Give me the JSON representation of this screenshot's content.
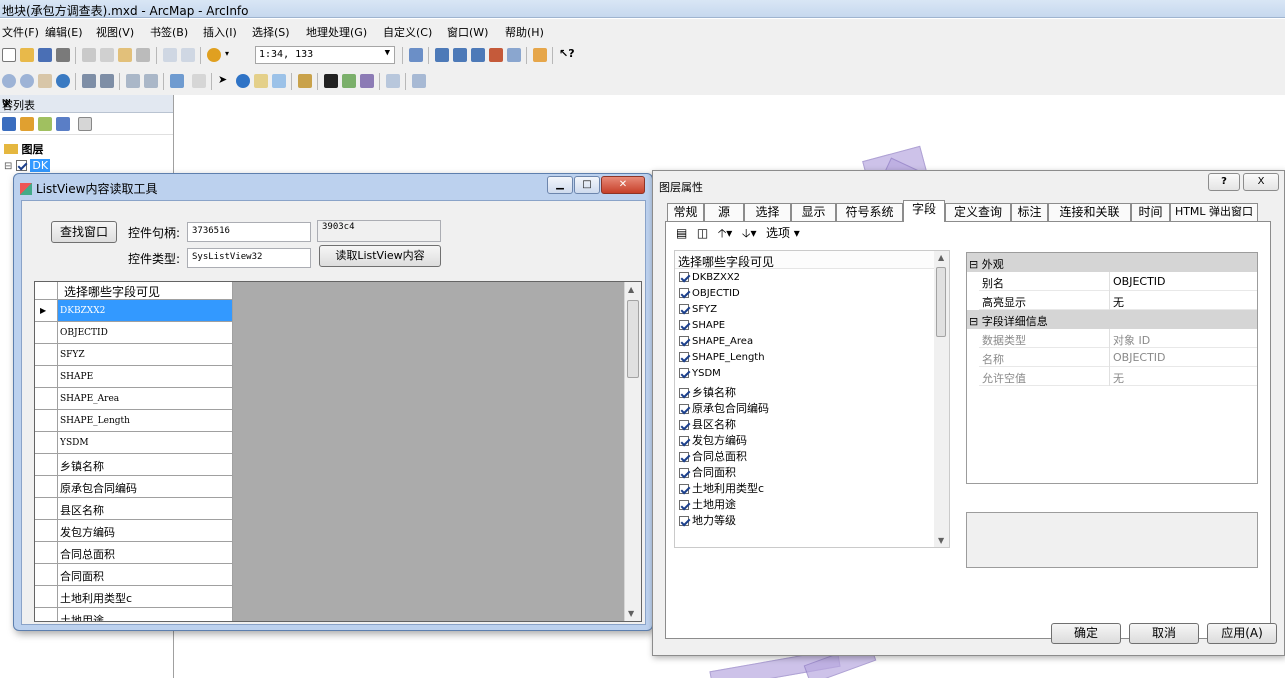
{
  "app": {
    "title": "地块(承包方调查表).mxd - ArcMap - ArcInfo",
    "menu": [
      "文件(F)",
      "编辑(E)",
      "视图(V)",
      "书签(B)",
      "插入(I)",
      "选择(S)",
      "地理处理(G)",
      "自定义(C)",
      "窗口(W)",
      "帮助(H)"
    ],
    "scale": "1:34, 133"
  },
  "toc": {
    "title": "容列表",
    "pin": "Ψ",
    "close": "×",
    "layers_group": "图层",
    "layer_name": "DK"
  },
  "listview_tool": {
    "title": "ListView内容读取工具",
    "find_button": "查找窗口",
    "handle_label": "控件句柄:",
    "handle_value": "3736516",
    "handle_hex": "3903c4",
    "type_label": "控件类型:",
    "type_value": "SysListView32",
    "read_button": "读取ListView内容",
    "grid_header": "选择哪些字段可见",
    "row_marker": "▶",
    "rows": [
      "DKBZXX2",
      "OBJECTID",
      "SFYZ",
      "SHAPE",
      "SHAPE_Area",
      "SHAPE_Length",
      "YSDM",
      "乡镇名称",
      "原承包合同编码",
      "县区名称",
      "发包方编码",
      "合同总面积",
      "合同面积",
      "土地利用类型c",
      "土地用途"
    ]
  },
  "layer_props": {
    "title": "图层属性",
    "help": "?",
    "close": "X",
    "tabs": [
      "常规",
      "源",
      "选择",
      "显示",
      "符号系统",
      "字段",
      "定义查询",
      "标注",
      "连接和关联",
      "时间",
      "HTML 弹出窗口"
    ],
    "active_tab": "字段",
    "options_label": "选项 ▾",
    "field_list_header": "选择哪些字段可见",
    "fields": [
      "DKBZXX2",
      "OBJECTID",
      "SFYZ",
      "SHAPE",
      "SHAPE_Area",
      "SHAPE_Length",
      "YSDM",
      "乡镇名称",
      "原承包合同编码",
      "县区名称",
      "发包方编码",
      "合同总面积",
      "合同面积",
      "土地利用类型c",
      "土地用途",
      "地力等级"
    ],
    "appearance_cat": "外观",
    "alias_key": "别名",
    "alias_val": "OBJECTID",
    "highlight_key": "高亮显示",
    "highlight_val": "无",
    "details_cat": "字段详细信息",
    "dtype_key": "数据类型",
    "dtype_val": "对象 ID",
    "name_key": "名称",
    "name_val": "OBJECTID",
    "nullable_key": "允许空值",
    "nullable_val": "无",
    "ok": "确定",
    "cancel": "取消",
    "apply": "应用(A)"
  },
  "colors": {
    "selection": "#3399ff",
    "parcels": "#b9a9e0",
    "window_frame": "#bcd1ee"
  }
}
